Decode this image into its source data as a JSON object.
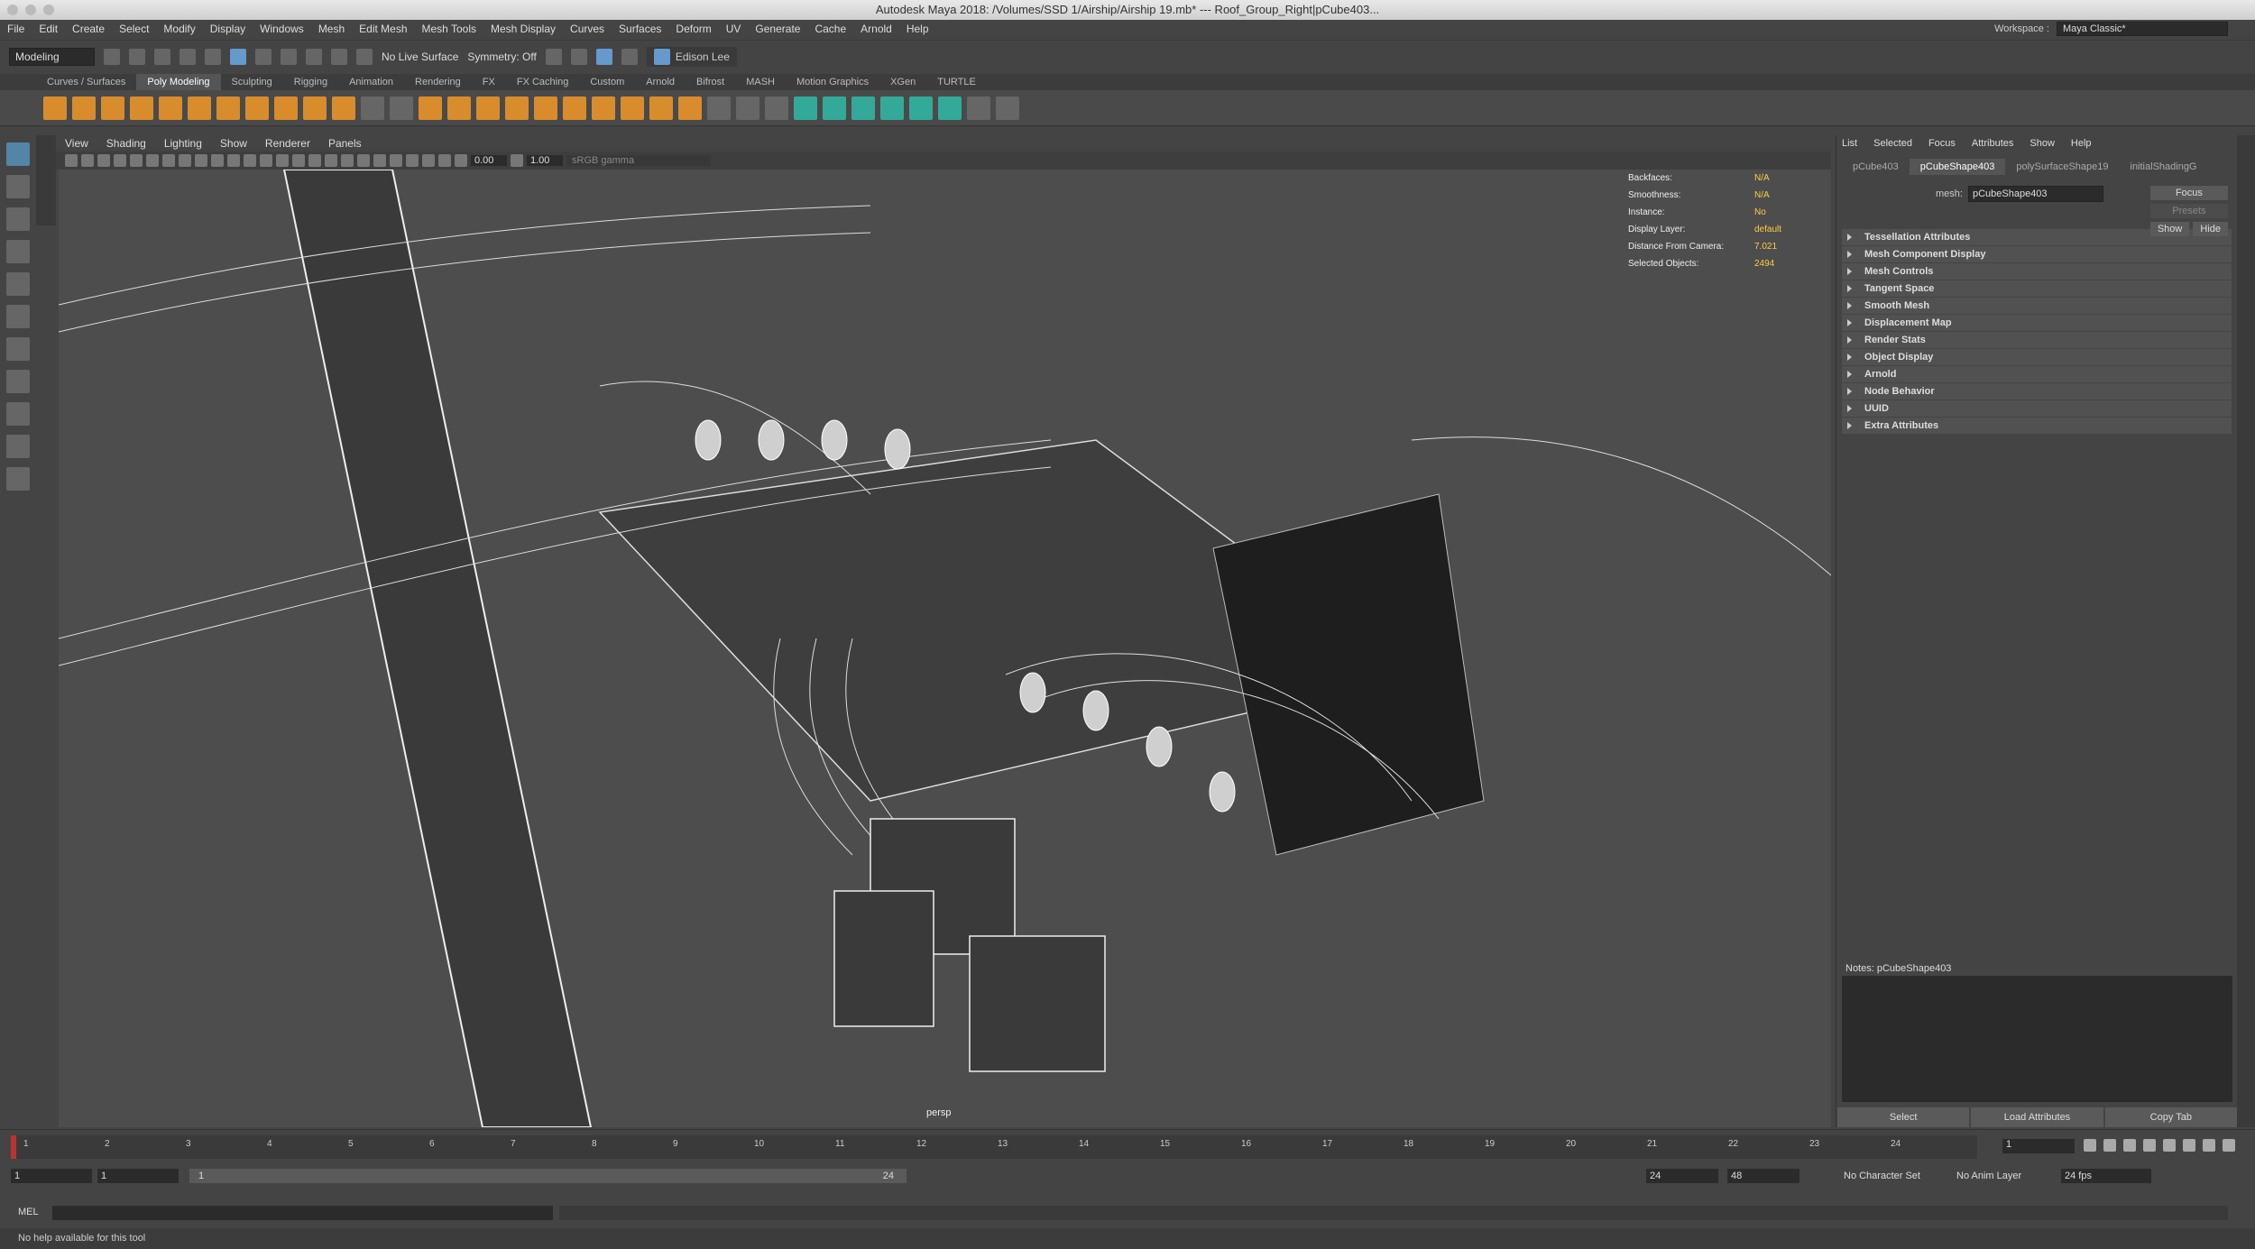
{
  "window": {
    "title": "Autodesk Maya 2018: /Volumes/SSD 1/Airship/Airship 19.mb*  ---  Roof_Group_Right|pCube403..."
  },
  "menubar": [
    "File",
    "Edit",
    "Create",
    "Select",
    "Modify",
    "Display",
    "Windows",
    "Mesh",
    "Edit Mesh",
    "Mesh Tools",
    "Mesh Display",
    "Curves",
    "Surfaces",
    "Deform",
    "UV",
    "Generate",
    "Cache",
    "Arnold",
    "Help"
  ],
  "workspace": {
    "label": "Workspace :",
    "value": "Maya Classic*"
  },
  "statusline": {
    "menuset": "Modeling",
    "live_surface": "No Live Surface",
    "symmetry": "Symmetry: Off",
    "user": "Edison Lee"
  },
  "shelf_tabs": [
    "Curves / Surfaces",
    "Poly Modeling",
    "Sculpting",
    "Rigging",
    "Animation",
    "Rendering",
    "FX",
    "FX Caching",
    "Custom",
    "Arnold",
    "Bifrost",
    "MASH",
    "Motion Graphics",
    "XGen",
    "TURTLE"
  ],
  "active_shelf": "Poly Modeling",
  "viewport_menu": [
    "View",
    "Shading",
    "Lighting",
    "Show",
    "Renderer",
    "Panels"
  ],
  "viewport_toolbar": {
    "exposure": "0.00",
    "gamma_value": "1.00",
    "colorspace": "sRGB gamma"
  },
  "hud": [
    {
      "k": "Backfaces:",
      "v": "N/A"
    },
    {
      "k": "Smoothness:",
      "v": "N/A"
    },
    {
      "k": "Instance:",
      "v": "No"
    },
    {
      "k": "Display Layer:",
      "v": "default"
    },
    {
      "k": "Distance From Camera:",
      "v": "7.021"
    },
    {
      "k": "Selected Objects:",
      "v": "2494"
    }
  ],
  "camera": "persp",
  "attribute_editor": {
    "menu": [
      "List",
      "Selected",
      "Focus",
      "Attributes",
      "Show",
      "Help"
    ],
    "tabs": [
      "pCube403",
      "pCubeShape403",
      "polySurfaceShape19",
      "initialShadingG"
    ],
    "active_tab": "pCubeShape403",
    "mesh_label": "mesh:",
    "mesh_value": "pCubeShape403",
    "focus": "Focus",
    "presets": "Presets",
    "show": "Show",
    "hide": "Hide",
    "sections": [
      "Tessellation Attributes",
      "Mesh Component Display",
      "Mesh Controls",
      "Tangent Space",
      "Smooth Mesh",
      "Displacement Map",
      "Render Stats",
      "Object Display",
      "Arnold",
      "Node Behavior",
      "UUID",
      "Extra Attributes"
    ],
    "notes_label": "Notes:  pCubeShape403",
    "buttons": [
      "Select",
      "Load Attributes",
      "Copy Tab"
    ]
  },
  "timeline": {
    "ticks": [
      "1",
      "2",
      "3",
      "4",
      "5",
      "6",
      "7",
      "8",
      "9",
      "10",
      "11",
      "12",
      "13",
      "14",
      "15",
      "16",
      "17",
      "18",
      "19",
      "20",
      "21",
      "22",
      "23",
      "24"
    ],
    "current": "1"
  },
  "range": {
    "start": "1",
    "start2": "1",
    "bar_start": "1",
    "bar_end": "24",
    "end": "24",
    "end2": "48",
    "character_set": "No Character Set",
    "anim_layer": "No Anim Layer",
    "fps": "24 fps"
  },
  "command": {
    "label": "MEL"
  },
  "help": "No help available for this tool"
}
